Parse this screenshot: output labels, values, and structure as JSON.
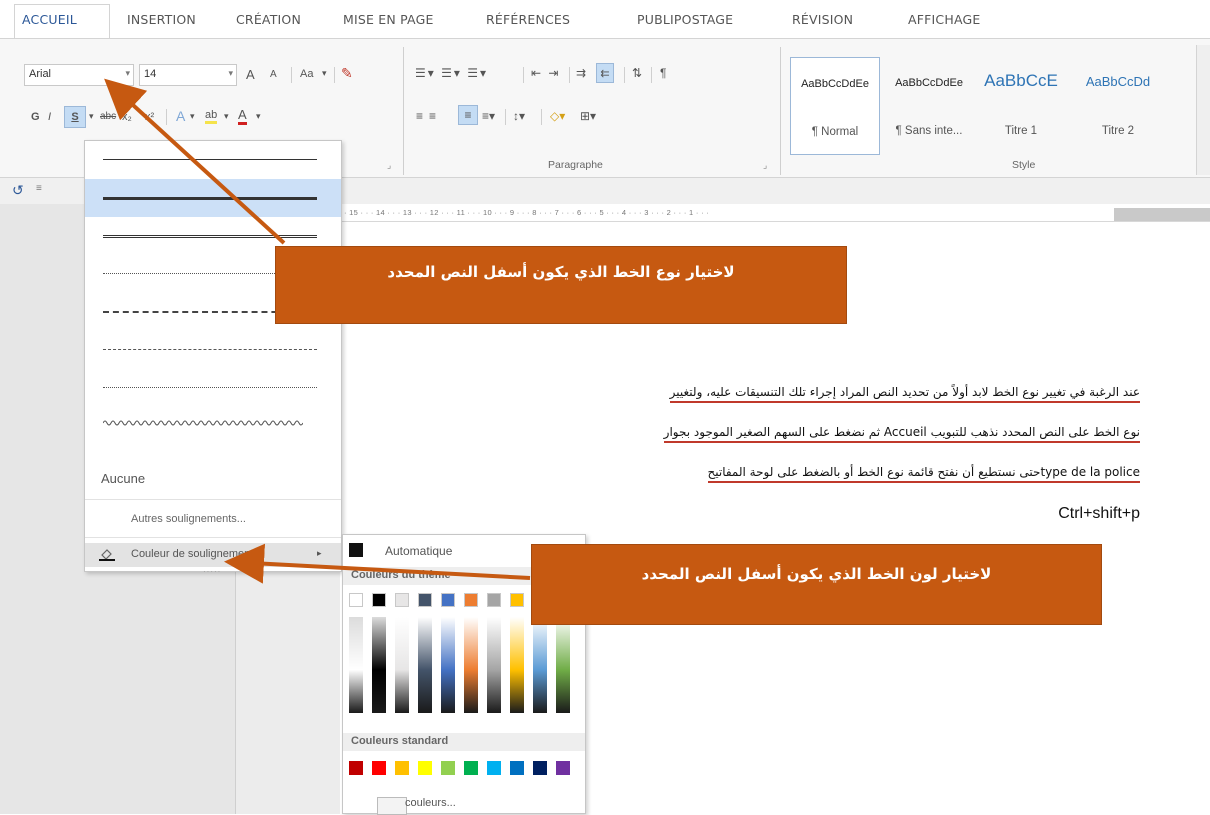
{
  "ribbon_tabs": [
    "ACCUEIL",
    "INSERTION",
    "CRÉATION",
    "MISE EN PAGE",
    "RÉFÉRENCES",
    "PUBLIPOSTAGE",
    "RÉVISION",
    "AFFICHAGE"
  ],
  "font": {
    "name": "Arial",
    "size": "14",
    "grow_label": "A",
    "shrink_label": "A",
    "case_label": "Aa",
    "bold_label": "G",
    "italic_label": "I",
    "underline_label": "S",
    "strike_label": "abc",
    "subscript_label": "x₂",
    "superscript_label": "x²",
    "font_color_label": "A",
    "highlight_label": "ab"
  },
  "paragraph_group_label": "Paragraphe",
  "styles": {
    "group_label": "Style",
    "items": [
      {
        "preview": "AaBbCcDdEe",
        "name": "¶ Normal"
      },
      {
        "preview": "AaBbCcDdEe",
        "name": "¶ Sans inte..."
      },
      {
        "preview": "AaBbCcE",
        "name": "Titre 1"
      },
      {
        "preview": "AaBbCcDd",
        "name": "Titre 2"
      }
    ]
  },
  "ruler_text": "· 15 · · · 14 · · · 13 · · · 12 · · · 11 · · · 10 · · · 9 · · · 8 · · · 7 · · · 6 · · · 5 · · · 4 · · · 3 · · · 2 · · · 1 · · ·",
  "underline_menu": {
    "none_label": "Aucune",
    "more_label": "Autres soulignements...",
    "color_label": "Couleur de soulignement"
  },
  "color_submenu": {
    "automatic_label": "Automatique",
    "theme_label": "Couleurs du thème",
    "standard_label": "Couleurs standard",
    "more_label": "couleurs...",
    "theme_colors": [
      "#ffffff",
      "#000000",
      "#e7e6e6",
      "#44546a",
      "#4472c4",
      "#ed7d31",
      "#a5a5a5",
      "#ffc000",
      "#5b9bd5",
      "#70ad47"
    ],
    "standard_colors": [
      "#c00000",
      "#ff0000",
      "#ffc000",
      "#ffff00",
      "#92d050",
      "#00b050",
      "#00b0f0",
      "#0070c0",
      "#002060",
      "#7030a0"
    ]
  },
  "document_lines": [
    "عند الرغبة في تغيير نوع الخط لابد أولاً من تحديد النص المراد إجراء تلك التنسيقات عليه، ولتغيير",
    "نوع الخط على النص المحدد نذهب للتبويب Accueil ثم نضغط على السهم الصغير الموجود بجوار",
    "type de la policeحتى نستطيع أن نفتح قائمة نوع الخط أو بالضغط على لوحة المفاتيح",
    "Ctrl+shift+p"
  ],
  "callouts": {
    "line_type": "لاختيار نوع الخط الذي يكون أسفل النص المحدد",
    "line_color": "لاختيار لون الخط الذي يكون أسفل النص المحدد"
  },
  "colors": {
    "callout_bg": "#c65911",
    "arrow": "#c65911",
    "underline_red": "#c0392b",
    "selection": "#cce0f7"
  }
}
